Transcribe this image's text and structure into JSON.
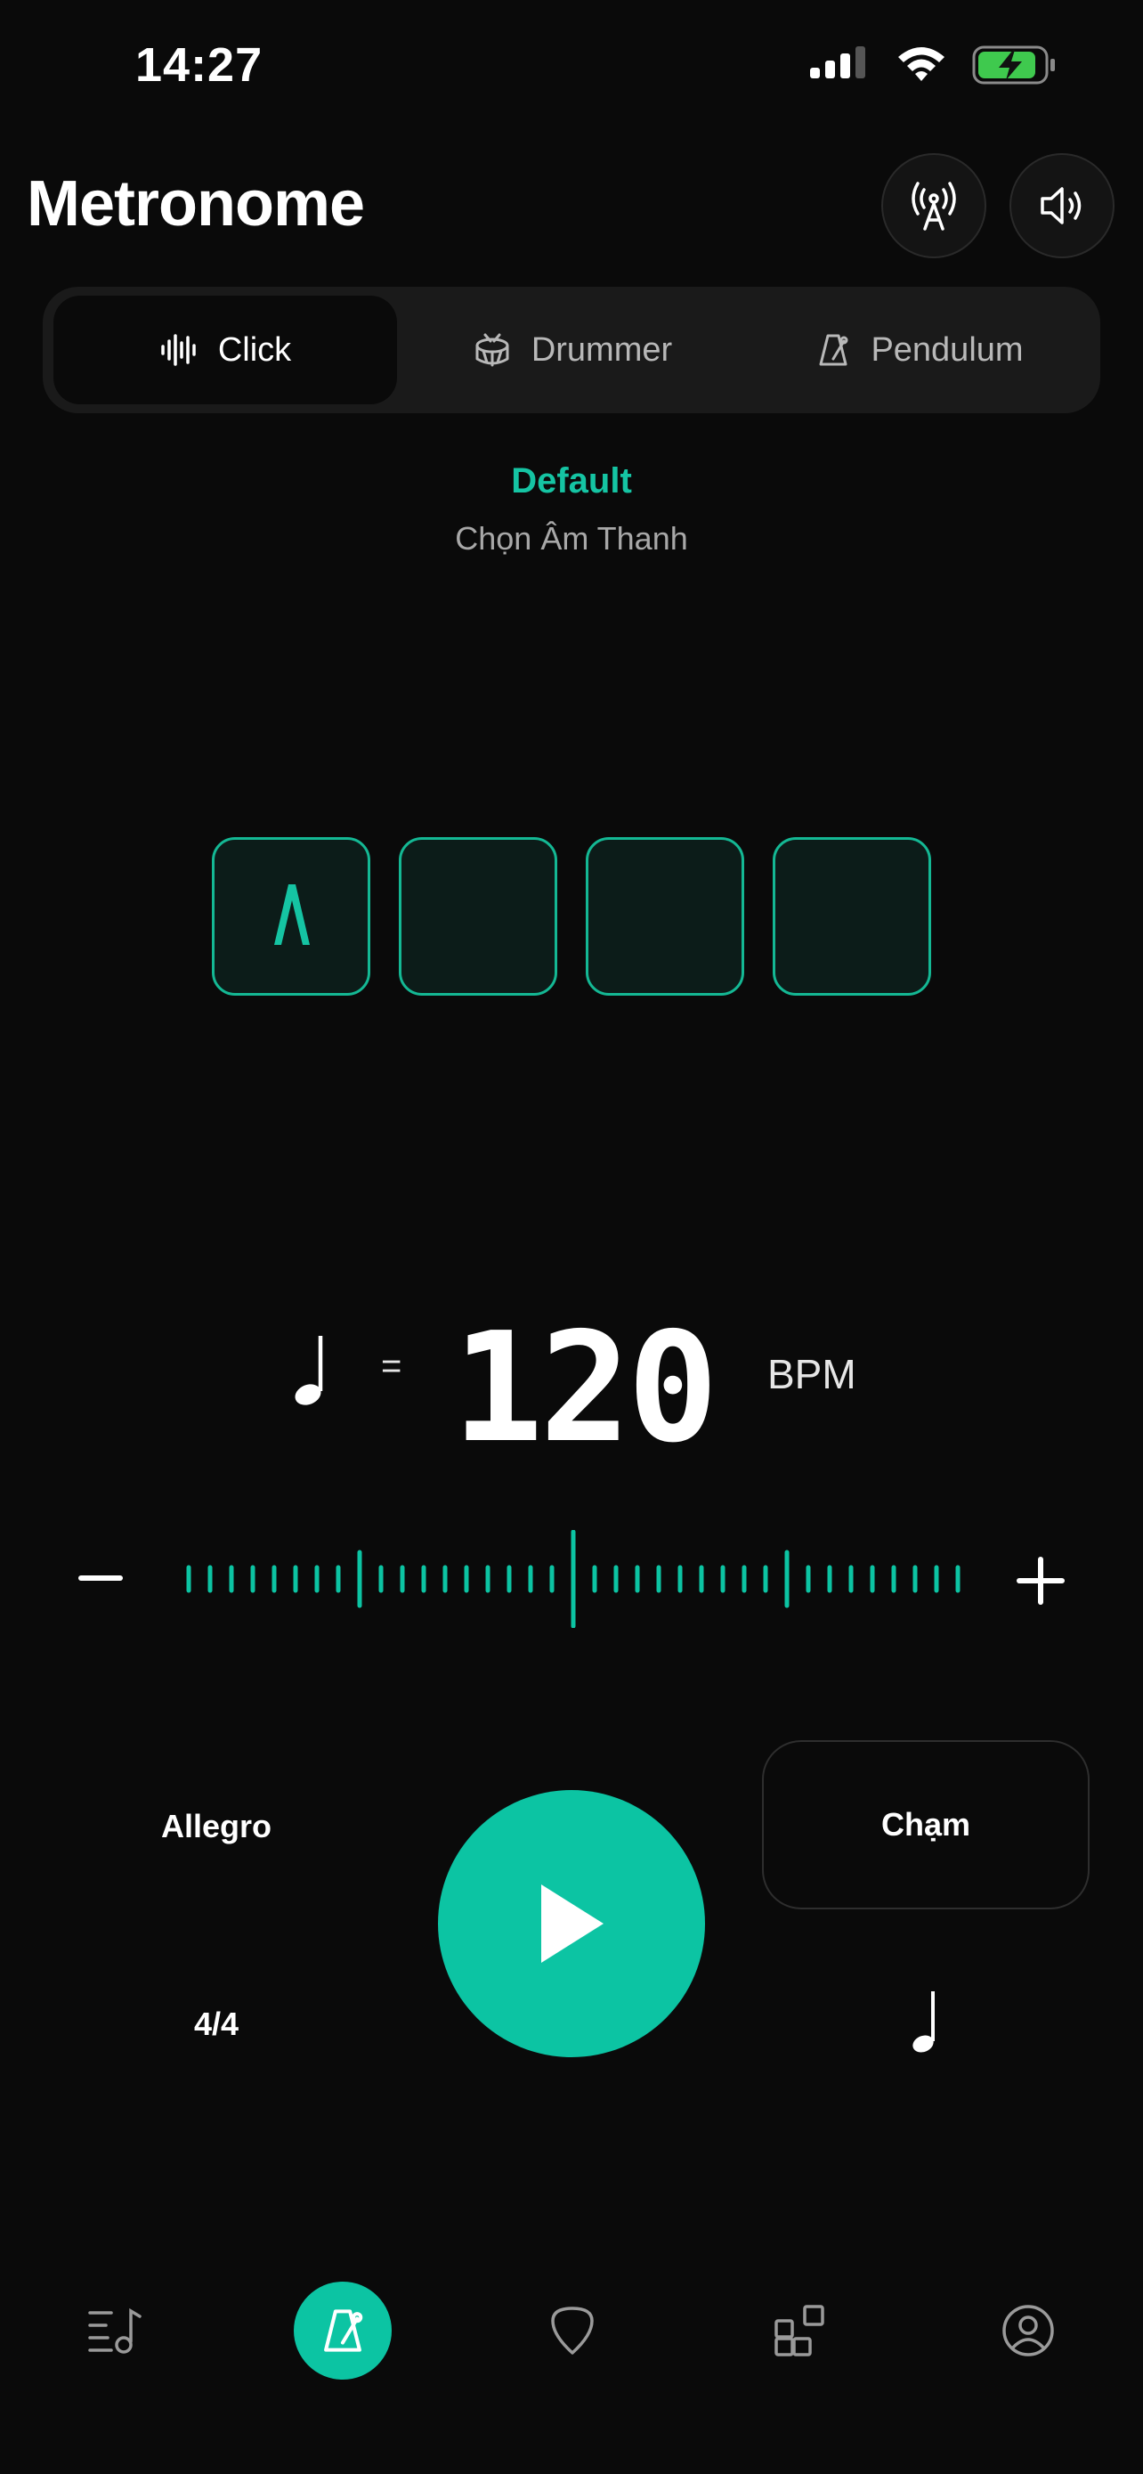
{
  "status_bar": {
    "time": "14:27",
    "icons": [
      "signal-icon",
      "wifi-icon",
      "battery-charging-icon"
    ],
    "battery_color": "#3fc94e"
  },
  "header": {
    "title": "Metronome",
    "actions": [
      "antenna-icon",
      "volume-icon"
    ]
  },
  "tabs": [
    {
      "label": "Click",
      "icon": "waveform-icon",
      "active": true
    },
    {
      "label": "Drummer",
      "icon": "drum-icon",
      "active": false
    },
    {
      "label": "Pendulum",
      "icon": "metronome-icon",
      "active": false
    }
  ],
  "sound": {
    "name": "Default",
    "action": "Chọn Âm Thanh"
  },
  "beats": {
    "count": 4,
    "accent_beat": 1
  },
  "tempo": {
    "equals": "=",
    "bpm": "120",
    "unit": "BPM"
  },
  "controls": {
    "tempo_marking": "Allegro",
    "time_signature": "4/4",
    "tap_label": "Chạm"
  },
  "nav": [
    {
      "name": "library",
      "icon": "music-list-icon",
      "active": false
    },
    {
      "name": "metronome",
      "icon": "metronome-icon",
      "active": true
    },
    {
      "name": "pick",
      "icon": "guitar-pick-icon",
      "active": false
    },
    {
      "name": "apps",
      "icon": "apps-icon",
      "active": false
    },
    {
      "name": "profile",
      "icon": "user-circle-icon",
      "active": false
    }
  ],
  "colors": {
    "accent": "#0cc4a3",
    "background": "#0a0a0a",
    "surface": "#1a1a1a"
  }
}
